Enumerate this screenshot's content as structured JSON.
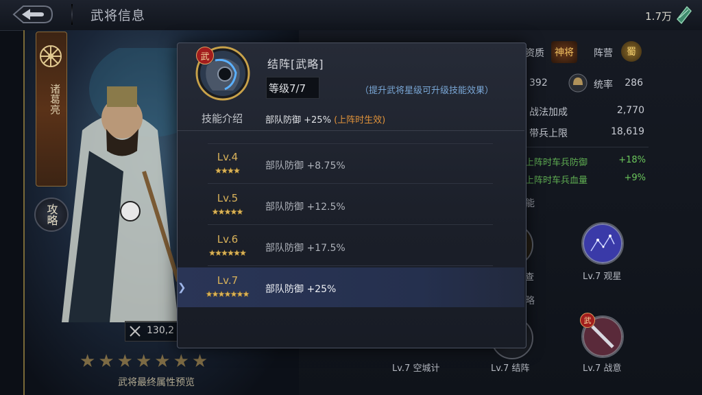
{
  "header": {
    "title": "武将信息",
    "currency": "1.7万",
    "currency_icon": "jade-gem-icon"
  },
  "hero": {
    "name": "诸葛亮",
    "strategy_label": "攻略",
    "power": "130,2",
    "stars_total": 7,
    "preview_label": "武将最终属性预览"
  },
  "right_panel": {
    "aptitude_label": "资质",
    "aptitude_badge": "神将",
    "faction_label": "阵营",
    "faction_badge": "蜀",
    "stat_partial_value": "392",
    "command_label": "统率",
    "command_value": "286",
    "tactics_bonus_label": "战法加成",
    "tactics_bonus_value": "2,770",
    "troop_cap_label": "带兵上限",
    "troop_cap_value": "18,619",
    "bonus_rows": [
      {
        "label": "上阵时车兵防御",
        "value": "+18%"
      },
      {
        "label": "上阵时车兵血量",
        "value": "+9%"
      }
    ],
    "section_skill_partial": "能",
    "section_strategy_partial": "略",
    "skill_partial_caption": "查",
    "skills": [
      {
        "caption": "Lv.7 观星"
      },
      {
        "caption": "Lv.7 空城计"
      },
      {
        "caption": "Lv.7 结阵"
      },
      {
        "caption": "Lv.7 战意"
      }
    ],
    "wu_badge": "武"
  },
  "modal": {
    "skill_name": "结阵[武略]",
    "type_badge": "武",
    "level_text": "等级7/7",
    "hint": "（提升武将星级可升级技能效果）",
    "intro_label": "技能介绍",
    "current_effect": "部队防御 +25%",
    "current_condition": "(上阵时生效)",
    "levels": [
      {
        "label": "Lv.4",
        "stars": 4,
        "effect": "部队防御 +8.75%"
      },
      {
        "label": "Lv.5",
        "stars": 5,
        "effect": "部队防御 +12.5%"
      },
      {
        "label": "Lv.6",
        "stars": 6,
        "effect": "部队防御 +17.5%"
      },
      {
        "label": "Lv.7",
        "stars": 7,
        "effect": "部队防御 +25%",
        "selected": true
      }
    ]
  },
  "colors": {
    "gold": "#d9b25a",
    "hint_blue": "#7aa7d6",
    "condition_orange": "#e0923a",
    "bonus_green": "#5fae52",
    "selected_row": "#2a3556"
  }
}
